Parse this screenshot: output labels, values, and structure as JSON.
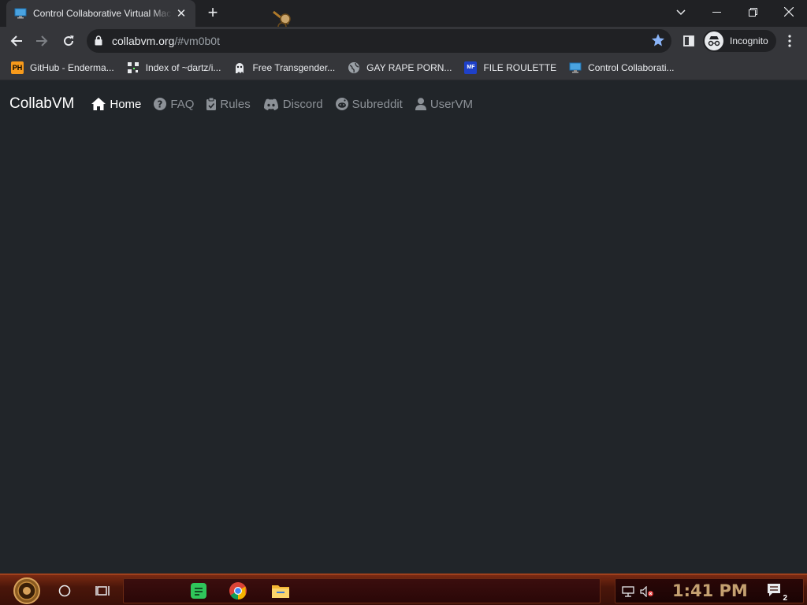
{
  "browser": {
    "tab": {
      "title": "Control Collaborative Virtual Machine",
      "favicon": "monitor-icon"
    },
    "address": {
      "host": "collabvm.org",
      "path": "/#vm0b0t"
    },
    "profile": {
      "label": "Incognito"
    },
    "bookmarks": [
      {
        "label": "GitHub - Enderma...",
        "icon": "ph-icon",
        "icon_text": "PH"
      },
      {
        "label": "Index of ~dartz/i...",
        "icon": "qr-icon",
        "icon_text": ""
      },
      {
        "label": "Free Transgender...",
        "icon": "ghost-icon",
        "icon_text": ""
      },
      {
        "label": "GAY RAPE PORN...",
        "icon": "globe-icon",
        "icon_text": ""
      },
      {
        "label": "FILE ROULETTE",
        "icon": "mf-icon",
        "icon_text": "MF"
      },
      {
        "label": "Control Collaborati...",
        "icon": "monitor-icon",
        "icon_text": ""
      }
    ]
  },
  "site": {
    "brand": "CollabVM",
    "nav": [
      {
        "label": "Home",
        "icon": "home-icon",
        "active": true
      },
      {
        "label": "FAQ",
        "icon": "question-icon",
        "active": false
      },
      {
        "label": "Rules",
        "icon": "clipboard-icon",
        "active": false
      },
      {
        "label": "Discord",
        "icon": "discord-icon",
        "active": false
      },
      {
        "label": "Subreddit",
        "icon": "reddit-icon",
        "active": false
      },
      {
        "label": "UserVM",
        "icon": "user-icon",
        "active": false
      }
    ]
  },
  "taskbar": {
    "clock": "1:41 PM",
    "notifications": "2",
    "apps": [
      "notes-app-icon",
      "chrome-icon",
      "file-explorer-icon"
    ]
  },
  "colors": {
    "page_bg": "#212529",
    "nav_inactive": "#8c9197",
    "nav_active": "#ffffff",
    "chrome_dark": "#202124",
    "chrome_toolbar": "#35363a",
    "star": "#8ab4f8",
    "taskbar": "#4a160a",
    "clock": "#c4a070"
  }
}
